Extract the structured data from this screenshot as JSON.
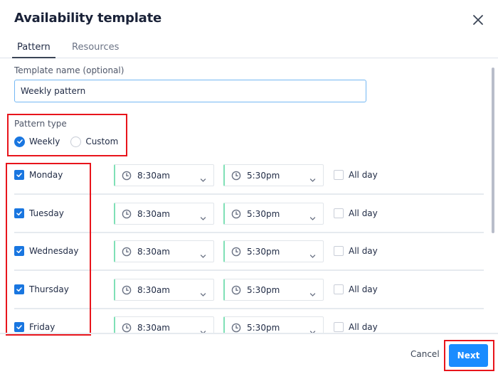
{
  "dialog": {
    "title": "Availability template",
    "close_icon": "close-icon"
  },
  "tabs": [
    {
      "label": "Pattern",
      "active": true
    },
    {
      "label": "Resources",
      "active": false
    }
  ],
  "template_name": {
    "label": "Template name (optional)",
    "value": "Weekly pattern"
  },
  "pattern_type": {
    "label": "Pattern type",
    "options": [
      {
        "label": "Weekly",
        "selected": true
      },
      {
        "label": "Custom",
        "selected": false
      }
    ]
  },
  "days": [
    {
      "day": "Monday",
      "checked": true,
      "start": "8:30am",
      "end": "5:30pm",
      "all_day_label": "All day",
      "all_day": false
    },
    {
      "day": "Tuesday",
      "checked": true,
      "start": "8:30am",
      "end": "5:30pm",
      "all_day_label": "All day",
      "all_day": false
    },
    {
      "day": "Wednesday",
      "checked": true,
      "start": "8:30am",
      "end": "5:30pm",
      "all_day_label": "All day",
      "all_day": false
    },
    {
      "day": "Thursday",
      "checked": true,
      "start": "8:30am",
      "end": "5:30pm",
      "all_day_label": "All day",
      "all_day": false
    },
    {
      "day": "Friday",
      "checked": true,
      "start": "8:30am",
      "end": "5:30pm",
      "all_day_label": "All day",
      "all_day": false
    }
  ],
  "footer": {
    "cancel_label": "Cancel",
    "next_label": "Next"
  },
  "colors": {
    "accent": "#1a8cff",
    "checkbox": "#1976e0",
    "highlight": "#e8141b",
    "select_accent": "#7fe0b6"
  }
}
